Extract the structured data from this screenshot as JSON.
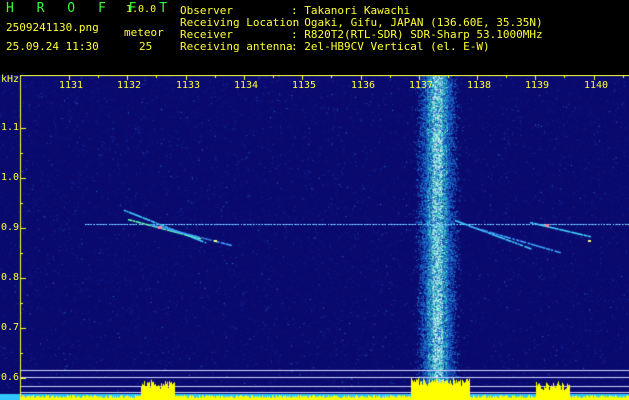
{
  "header": {
    "app_name": "H R O F F T",
    "version": "1.0.0",
    "filename": "2509241130.png",
    "datetime": "25.09.24 11:30",
    "meteor_label": "meteor",
    "meteor_count": "25",
    "fields": [
      {
        "label": "Observer",
        "value": ": Takanori Kawachi"
      },
      {
        "label": "Receiving Location",
        "value": ": Ogaki, Gifu, JAPAN (136.60E, 35.35N)"
      },
      {
        "label": "Receiver",
        "value": ": R820T2(RTL-SDR) SDR-Sharp 53.1000MHz"
      },
      {
        "label": "Receiving antenna",
        "value": ": 2el-HB9CV Vertical (el. E-W)"
      }
    ]
  },
  "chart_data": {
    "type": "heatmap",
    "x_unit": "Hz",
    "y_unit": "kHz",
    "x_ticks": [
      "1131",
      "1132",
      "1133",
      "1134",
      "1135",
      "1136",
      "1137",
      "1138",
      "1139",
      "1140"
    ],
    "y_ticks": [
      "1.1",
      "1.0",
      "0.9",
      "0.8",
      "0.7",
      "0.6"
    ],
    "y_label": "kHz",
    "colors": {
      "background": "#0a0a6e",
      "axis": "#ffff33",
      "text": "#33ff33",
      "signal": "#ffff00"
    }
  }
}
